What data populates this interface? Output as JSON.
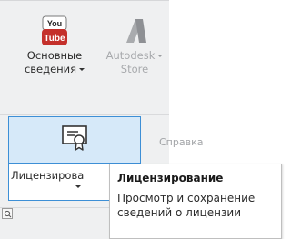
{
  "ribbon": {
    "basics_button": {
      "label_line1": "Основные",
      "label_line2": "сведения",
      "icon_text_top": "You",
      "icon_text_bottom": "Tube",
      "icon": "youtube-icon"
    },
    "store_button": {
      "label_line1": "Autodesk",
      "label_line2": "Store",
      "icon": "autodesk-logo-icon"
    },
    "licensing_button": {
      "label": "Лицензирова",
      "icon": "certificate-icon"
    },
    "help_panel_label": "Справка",
    "corner_icon": "search-icon"
  },
  "tooltip": {
    "title": "Лицензирование",
    "description_line1": "Просмотр и сохранение",
    "description_line2": "сведений о лицензии"
  },
  "colors": {
    "ribbon_bg": "#eff0f1",
    "selection_border": "#3d8fd6",
    "selection_fill": "#d6e9f9",
    "youtube_red": "#c4302b",
    "disabled_text": "#a8aaad"
  }
}
